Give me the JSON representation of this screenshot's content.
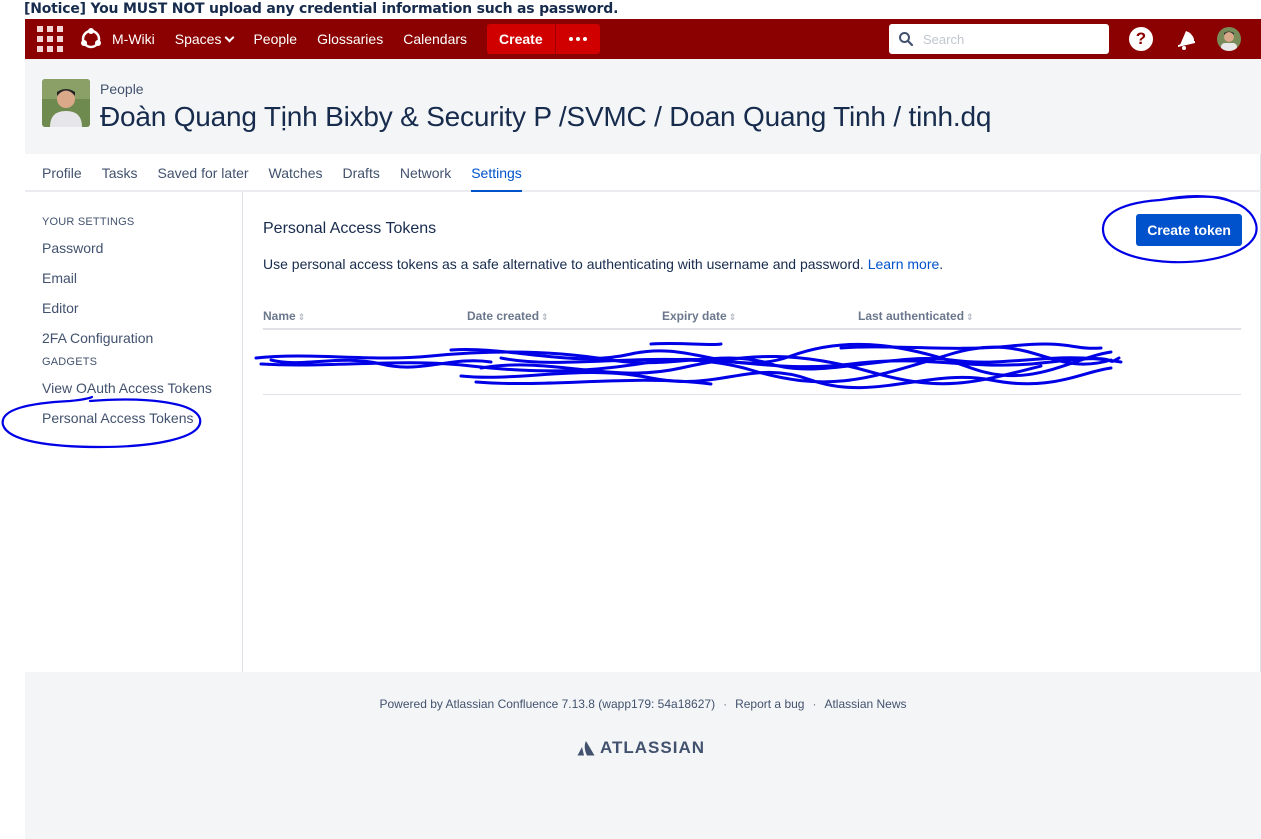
{
  "notice": "[Notice] You MUST NOT upload any credential information such as password.",
  "nav": {
    "site_name": "M-Wiki",
    "items": [
      "Spaces",
      "People",
      "Glossaries",
      "Calendars"
    ],
    "create_label": "Create",
    "search_placeholder": "Search",
    "help_label": "?"
  },
  "header": {
    "breadcrumb": "People",
    "title": "Đoàn Quang Tịnh Bixby & Security P /SVMC / Doan Quang Tinh / tinh.dq"
  },
  "tabs": [
    "Profile",
    "Tasks",
    "Saved for later",
    "Watches",
    "Drafts",
    "Network",
    "Settings"
  ],
  "active_tab": "Settings",
  "sidebar": {
    "your_settings_heading": "YOUR SETTINGS",
    "settings_items": [
      "Password",
      "Email",
      "Editor",
      "2FA Configuration"
    ],
    "gadgets_heading": "GADGETS",
    "gadget_items": [
      "View OAuth Access Tokens",
      "Personal Access Tokens"
    ]
  },
  "main": {
    "title": "Personal Access Tokens",
    "create_button": "Create token",
    "description": "Use personal access tokens as a safe alternative to authenticating with username and password.",
    "learn_more": "Learn more",
    "columns": [
      "Name",
      "Date created",
      "Expiry date",
      "Last authenticated"
    ]
  },
  "footer": {
    "powered_by": "Powered by Atlassian Confluence 7.13.8 (wapp179: 54a18627)",
    "report_bug": "Report a bug",
    "news": "Atlassian News",
    "logo_text": "ATLASSIAN"
  },
  "colors": {
    "nav_bg": "#8b0000",
    "create_bg": "#d00000",
    "accent": "#0052cc",
    "annotation": "#0000e6"
  }
}
